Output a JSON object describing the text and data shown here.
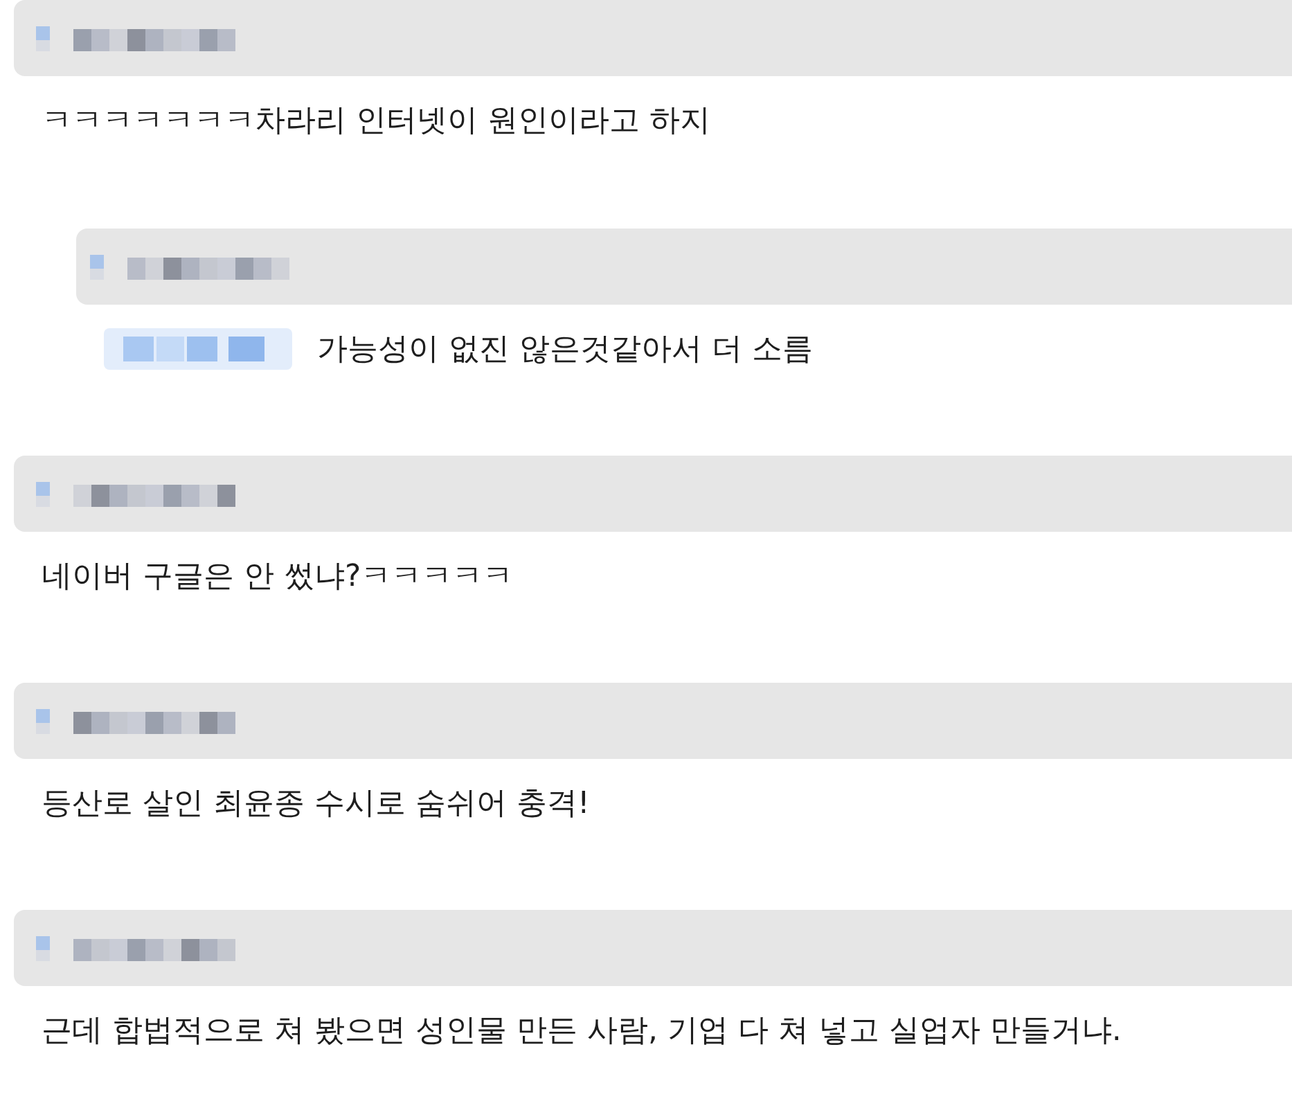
{
  "comments": [
    {
      "kind": "comment",
      "text": "ㅋㅋㅋㅋㅋㅋㅋ차라리 인터넷이 원인이라고 하지"
    },
    {
      "kind": "reply",
      "text": "가능성이 없진 않은것같아서 더 소름"
    },
    {
      "kind": "comment",
      "text": "네이버 구글은 안 썼냐?ㅋㅋㅋㅋㅋ"
    },
    {
      "kind": "comment",
      "text": "등산로 살인 최윤종 수시로 숨쉬어 충격!"
    },
    {
      "kind": "comment",
      "text": "근데 합법적으로 쳐 봤으면 성인물 만든 사람, 기업 다 쳐 넣고 실업자 만들거냐."
    }
  ]
}
